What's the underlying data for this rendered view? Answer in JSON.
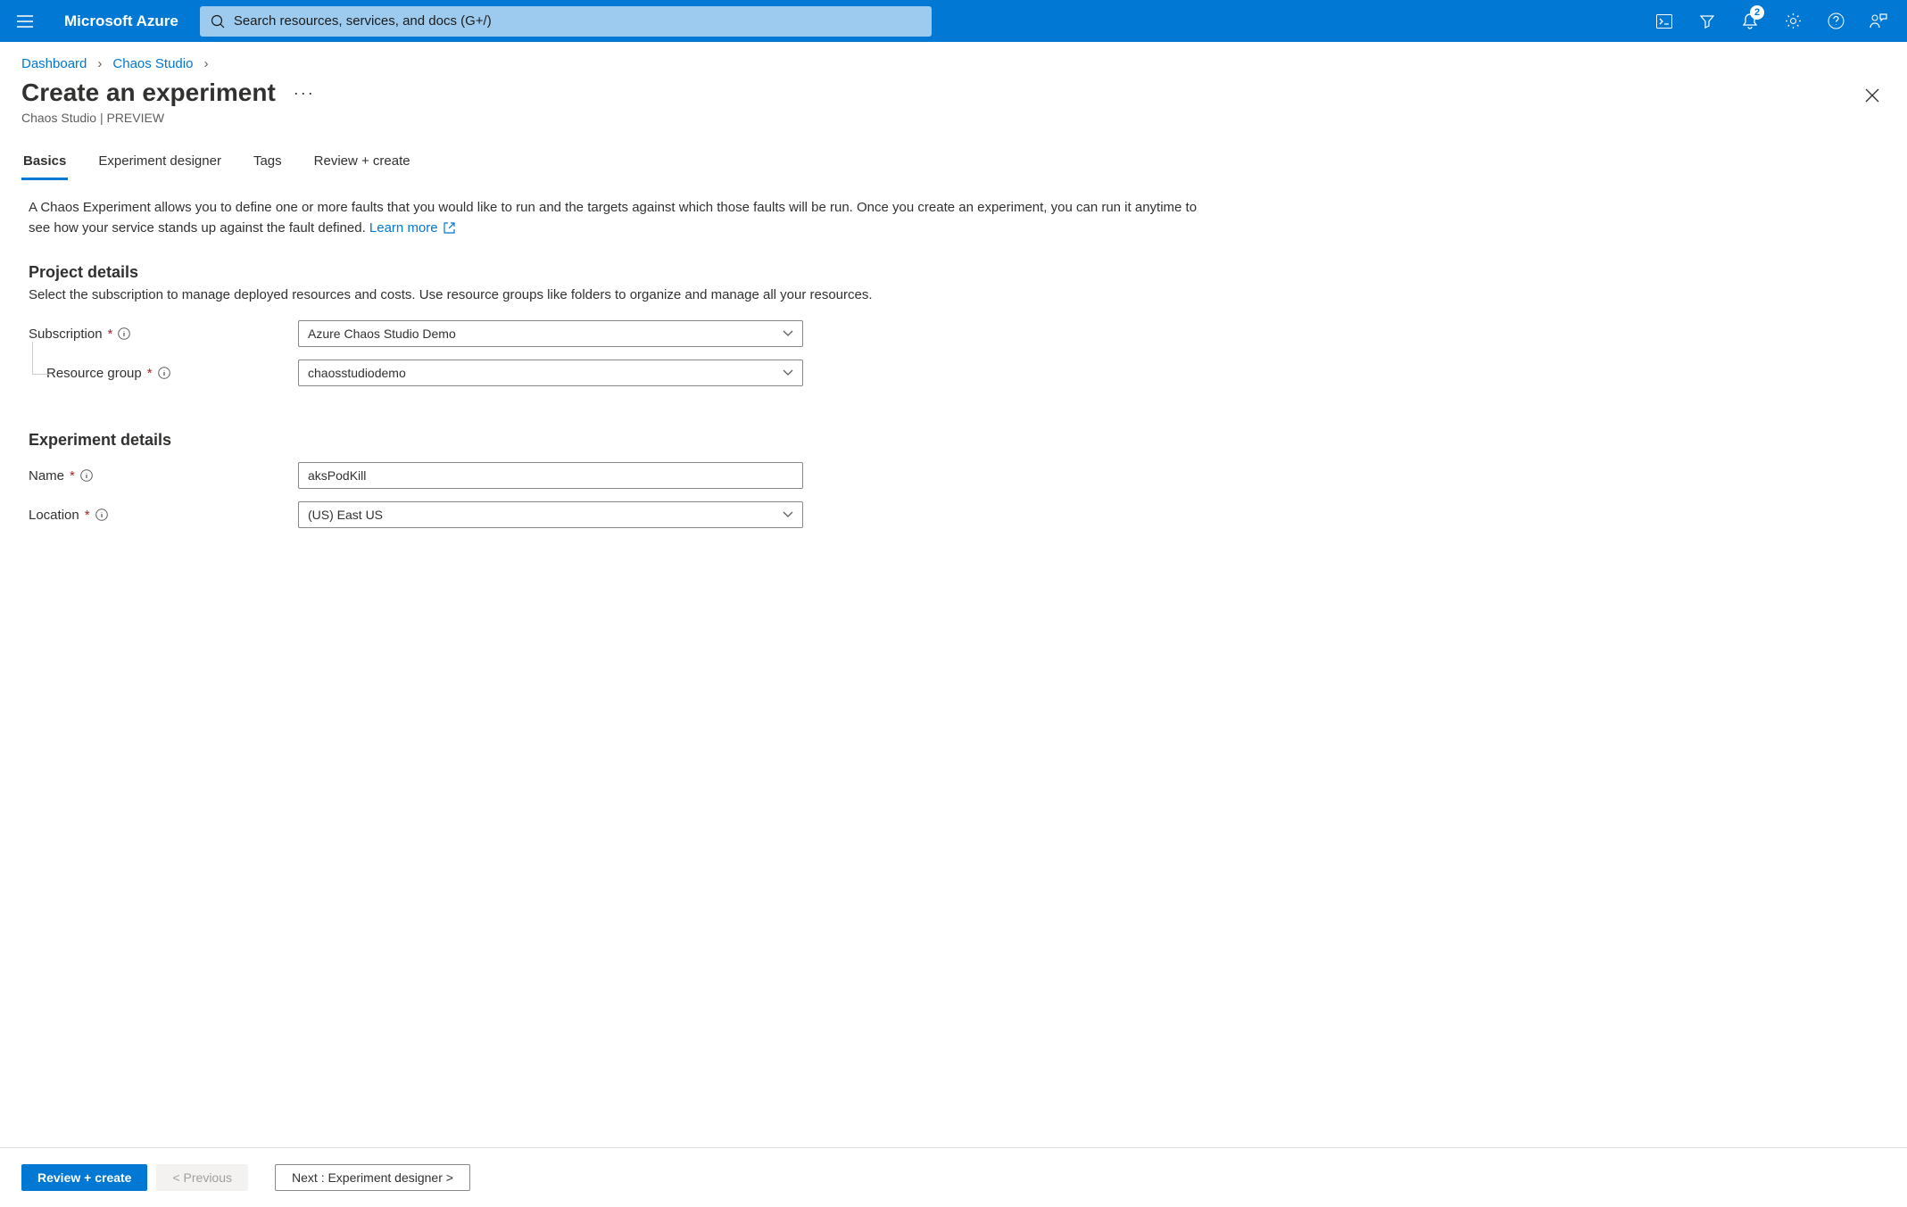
{
  "topbar": {
    "brand": "Microsoft Azure",
    "search_placeholder": "Search resources, services, and docs (G+/)",
    "notification_count": "2"
  },
  "breadcrumb": {
    "items": [
      "Dashboard",
      "Chaos Studio"
    ]
  },
  "header": {
    "title": "Create an experiment",
    "subtitle": "Chaos Studio | PREVIEW"
  },
  "tabs": {
    "items": [
      "Basics",
      "Experiment designer",
      "Tags",
      "Review + create"
    ],
    "active": 0
  },
  "intro": {
    "text": "A Chaos Experiment allows you to define one or more faults that you would like to run and the targets against which those faults will be run. Once you create an experiment, you can run it anytime to see how your service stands up against the fault defined. ",
    "link": "Learn more"
  },
  "project_details": {
    "title": "Project details",
    "desc": "Select the subscription to manage deployed resources and costs. Use resource groups like folders to organize and manage all your resources.",
    "subscription_label": "Subscription",
    "subscription_value": "Azure Chaos Studio Demo",
    "rg_label": "Resource group",
    "rg_value": "chaosstudiodemo"
  },
  "experiment_details": {
    "title": "Experiment details",
    "name_label": "Name",
    "name_value": "aksPodKill",
    "location_label": "Location",
    "location_value": "(US) East US"
  },
  "footer": {
    "review": "Review + create",
    "previous": "< Previous",
    "next": "Next : Experiment designer >"
  }
}
